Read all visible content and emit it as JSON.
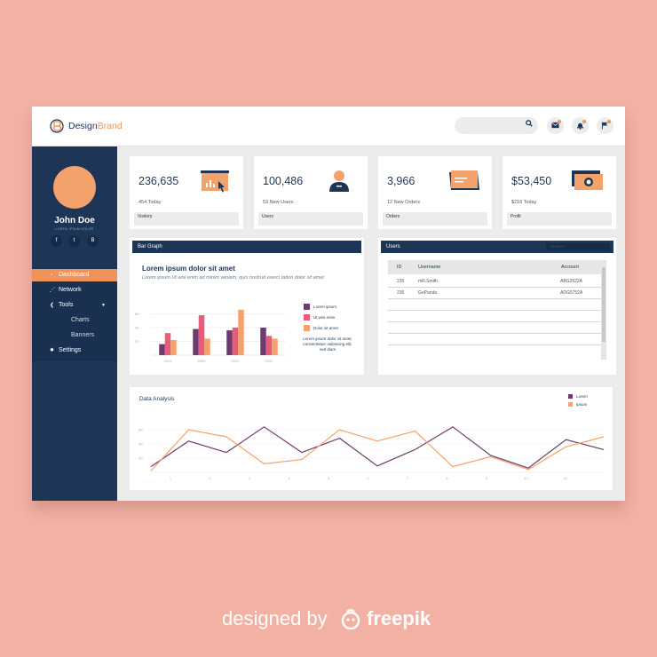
{
  "app": {
    "brand_prefix": "Design",
    "brand_suffix": "Brand"
  },
  "colors": {
    "navy": "#1d3557",
    "orange": "#f0935b",
    "pink": "#e45d7b",
    "purple": "#6d3b6e",
    "background": "#f2b1a3"
  },
  "header": {
    "icons": [
      "search-icon",
      "mail-icon",
      "bell-icon",
      "flag-icon"
    ]
  },
  "user": {
    "name": "John Doe",
    "subtitle": "LOREM IPSUM DOLOR",
    "social": [
      "f",
      "t",
      "B"
    ]
  },
  "sidebar": {
    "items": [
      {
        "label": "Dashboard",
        "icon": "dashboard-icon",
        "active": true
      },
      {
        "label": "Network",
        "icon": "network-icon"
      },
      {
        "label": "Tools",
        "icon": "tools-icon"
      },
      {
        "label": "Charts",
        "sub": true
      },
      {
        "label": "Banners",
        "sub": true
      },
      {
        "label": "Settings",
        "icon": "gear-icon"
      }
    ]
  },
  "kpis": [
    {
      "value": "236,635",
      "sub": "454 Today",
      "foot": "Visitors",
      "icon": "presentation-icon"
    },
    {
      "value": "100,486",
      "sub": "53 New Users",
      "foot": "Users",
      "icon": "user-icon"
    },
    {
      "value": "3,966",
      "sub": "12 New Orders",
      "foot": "Orders",
      "icon": "ticket-icon"
    },
    {
      "value": "$53,450",
      "sub": "$216 Today",
      "foot": "Profit",
      "icon": "camera-icon"
    }
  ],
  "bar_panel": {
    "header": "Bar Graph",
    "title": "Lorem ipsum dolor sit amet",
    "description": "Lorem ipsum Ut wisi enim ad minim veniam, quis nostrud exerci tation dolor sit amet",
    "legend": [
      "Lorem ipsum",
      "Ut wisi enim",
      "Dolor sit amet"
    ],
    "legend_note": "Lorem ipsum dolor sit amet, consectetuer adipiscing elit, sed diam"
  },
  "users_panel": {
    "header": "Users",
    "search": "SEARCH",
    "columns": [
      "ID",
      "Username",
      "Account"
    ],
    "rows": [
      {
        "id": "235",
        "username": "mR.Smith",
        "account": "ABG2622A"
      },
      {
        "id": "236",
        "username": "GoPanda",
        "account": "ADG5752A"
      }
    ]
  },
  "data_panel": {
    "title": "Data Analysis"
  },
  "chart_data": [
    {
      "type": "bar",
      "categories": [
        "2019",
        "2020",
        "2021",
        "2022"
      ],
      "ylim": [
        0,
        80
      ],
      "ytick_labels": [
        "20",
        "40",
        "60"
      ],
      "series": [
        {
          "name": "Lorem ipsum",
          "color": "#6d3b6e",
          "values": [
            16,
            38,
            36,
            40
          ]
        },
        {
          "name": "Ut wisi enim",
          "color": "#e45d7b",
          "values": [
            32,
            58,
            40,
            28
          ]
        },
        {
          "name": "Dolor sit amet",
          "color": "#f4a26b",
          "values": [
            22,
            24,
            66,
            24
          ]
        }
      ]
    },
    {
      "type": "line",
      "x": [
        "1",
        "2",
        "3",
        "4",
        "5",
        "6",
        "7",
        "8",
        "9",
        "10",
        "11"
      ],
      "ylim": [
        0,
        80
      ],
      "ytick_labels": [
        "20",
        "40",
        "60"
      ],
      "series": [
        {
          "name": "Lorem",
          "color": "#6d3b6e",
          "values": [
            8,
            44,
            28,
            64,
            28,
            48,
            9,
            32,
            64,
            24,
            6,
            46,
            32
          ]
        },
        {
          "name": "Ipsum",
          "color": "#f4a26b",
          "values": [
            2,
            60,
            50,
            12,
            18,
            60,
            44,
            58,
            8,
            22,
            4,
            36,
            50
          ]
        }
      ]
    }
  ],
  "watermark": {
    "text": "designed by",
    "brand": "freepik"
  }
}
